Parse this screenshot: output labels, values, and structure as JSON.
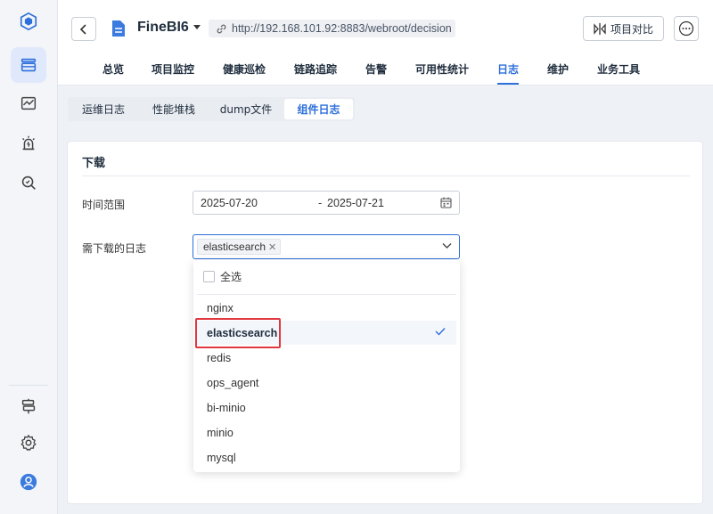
{
  "app": {
    "name": "FineBI6",
    "url": "http://192.168.101.92:8883/webroot/decision"
  },
  "header": {
    "compare_label": "项目对比"
  },
  "tabs": [
    {
      "label": "总览"
    },
    {
      "label": "项目监控"
    },
    {
      "label": "健康巡检"
    },
    {
      "label": "链路追踪"
    },
    {
      "label": "告警"
    },
    {
      "label": "可用性统计"
    },
    {
      "label": "日志",
      "active": true
    },
    {
      "label": "维护"
    },
    {
      "label": "业务工具"
    }
  ],
  "subtabs": [
    {
      "label": "运维日志"
    },
    {
      "label": "性能堆栈"
    },
    {
      "label": "dump文件"
    },
    {
      "label": "组件日志",
      "active": true
    }
  ],
  "download": {
    "title": "下载",
    "time_range_label": "时间范围",
    "date_start": "2025-07-20",
    "date_separator": "-",
    "date_end": "2025-07-21",
    "logs_label": "需下载的日志",
    "selected_tag": "elasticsearch"
  },
  "dropdown": {
    "select_all": "全选",
    "options": [
      {
        "label": "nginx"
      },
      {
        "label": "elasticsearch",
        "selected": true
      },
      {
        "label": "redis"
      },
      {
        "label": "ops_agent"
      },
      {
        "label": "bi-minio"
      },
      {
        "label": "minio"
      },
      {
        "label": "mysql"
      }
    ]
  },
  "sidebar_icons": [
    "cube-logo-icon",
    "layers-icon",
    "monitor-chart-icon",
    "alarm-icon",
    "search-shield-icon",
    "signpost-icon",
    "gear-icon",
    "user-avatar-icon"
  ],
  "colors": {
    "accent": "#2d6fdb",
    "highlight": "#e0383e"
  }
}
